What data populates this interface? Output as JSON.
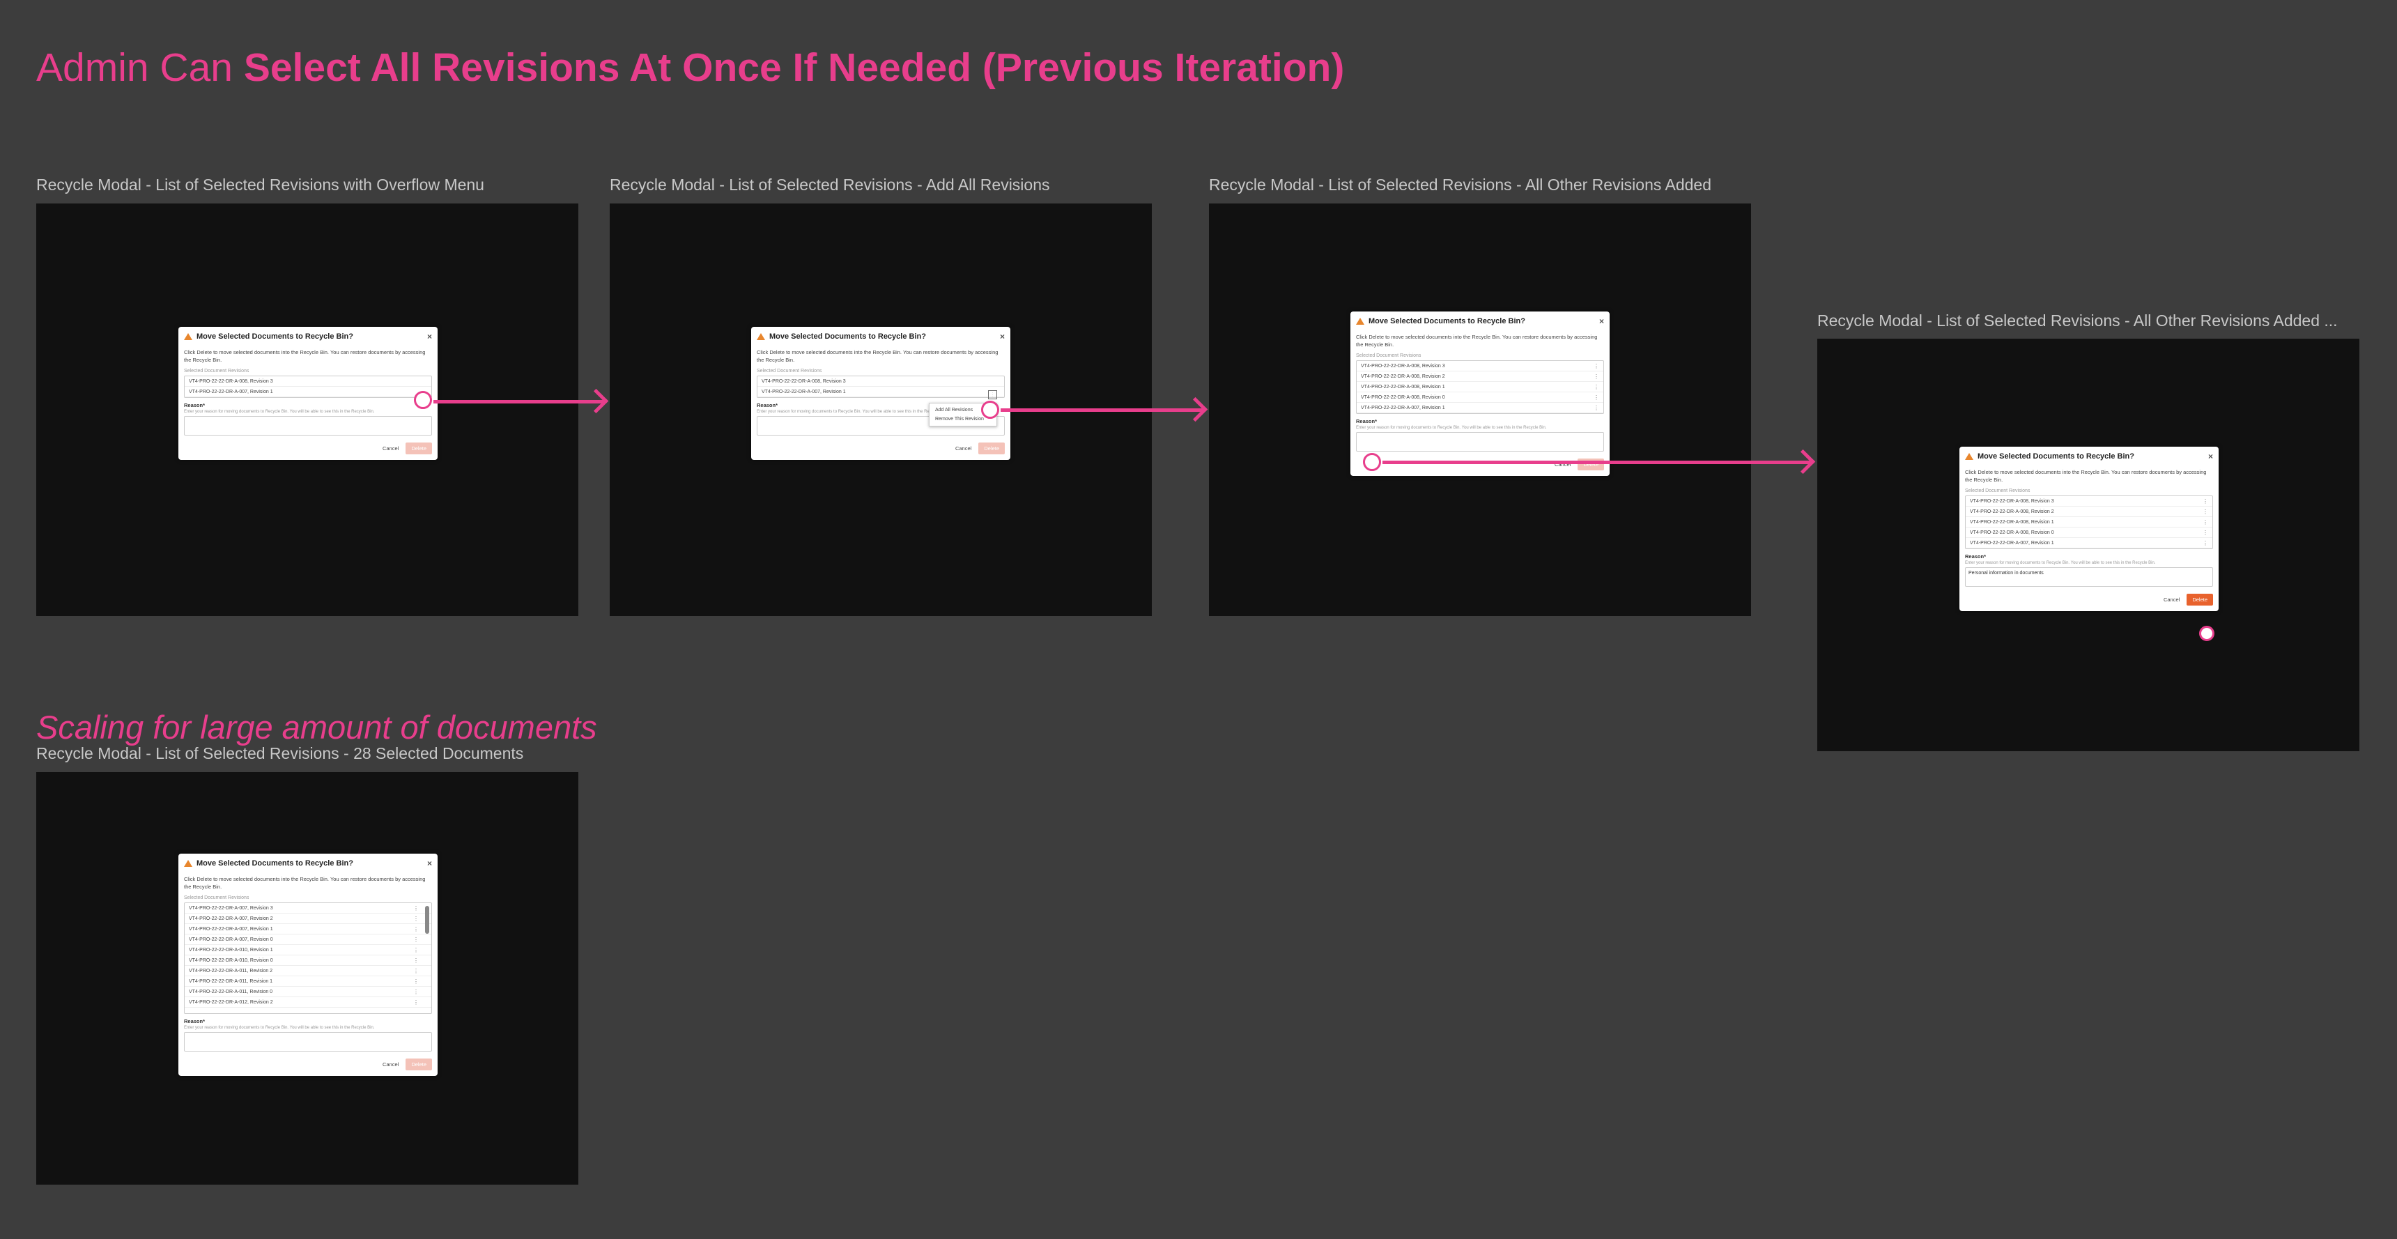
{
  "heading": {
    "light": "Admin Can ",
    "bold": "Select All Revisions At Once If Needed (Previous Iteration)"
  },
  "section2": "Scaling for large amount of documents",
  "labels": {
    "f1": "Recycle Modal - List of Selected Revisions with Overflow Menu",
    "f2": "Recycle Modal - List of Selected Revisions - Add All Revisions",
    "f3": "Recycle Modal - List of Selected Revisions - All Other Revisions Added",
    "f4": "Recycle Modal - List of Selected Revisions - All Other Revisions Added ...",
    "f5": "Recycle Modal - List of Selected Revisions - 28 Selected Documents"
  },
  "modal": {
    "title": "Move Selected Documents to Recycle Bin?",
    "desc": "Click Delete to move selected documents into the Recycle Bin. You can restore documents by accessing the Recycle Bin.",
    "list_label": "Selected Document Revisions",
    "reason_label": "Reason*",
    "hint": "Enter your reason for moving documents to Recycle Bin. You will be able to see this in the Recycle Bin.",
    "cancel": "Cancel",
    "delete": "Delete",
    "close": "×",
    "kebab": "⋮",
    "reason_value": "Personal information in documents"
  },
  "rows_short": [
    "VT4-PRO-22-22-DR-A-008, Revision 3",
    "VT4-PRO-22-22-DR-A-007, Revision 1"
  ],
  "rows_full": [
    "VT4-PRO-22-22-DR-A-008, Revision 3",
    "VT4-PRO-22-22-DR-A-008, Revision 2",
    "VT4-PRO-22-22-DR-A-008, Revision 1",
    "VT4-PRO-22-22-DR-A-008, Revision 0",
    "VT4-PRO-22-22-DR-A-007, Revision 1"
  ],
  "rows_28": [
    "VT4-PRO-22-22-DR-A-007, Revision 3",
    "VT4-PRO-22-22-DR-A-007, Revision 2",
    "VT4-PRO-22-22-DR-A-007, Revision 1",
    "VT4-PRO-22-22-DR-A-007, Revision 0",
    "VT4-PRO-22-22-DR-A-010, Revision 1",
    "VT4-PRO-22-22-DR-A-010, Revision 0",
    "VT4-PRO-22-22-DR-A-011, Revision 2",
    "VT4-PRO-22-22-DR-A-011, Revision 1",
    "VT4-PRO-22-22-DR-A-011, Revision 0",
    "VT4-PRO-22-22-DR-A-012, Revision 2"
  ],
  "menu": {
    "add_all": "Add All Revisions",
    "remove": "Remove This Revision"
  },
  "colors": {
    "accent": "#e83e8c",
    "warning": "#e8862d",
    "delete_active": "#e8622d",
    "delete_disabled": "#f4c2b8"
  }
}
